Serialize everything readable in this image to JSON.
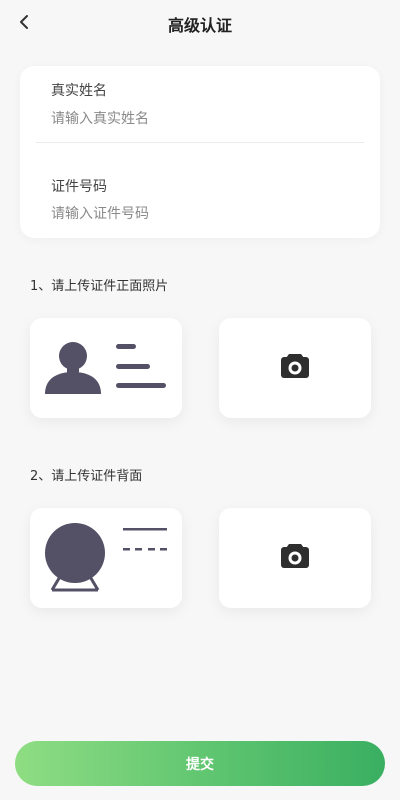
{
  "header": {
    "title": "高级认证",
    "back_icon": "chevron-left-icon"
  },
  "form": {
    "name_label": "真实姓名",
    "name_placeholder": "请输入真实姓名",
    "name_value": "",
    "id_label": "证件号码",
    "id_placeholder": "请输入证件号码",
    "id_value": ""
  },
  "upload_front": {
    "title": "1、请上传证件正面照片",
    "sample_icon": "id-card-front-sample-icon",
    "upload_icon": "camera-icon"
  },
  "upload_back": {
    "title": "2、请上传证件背面",
    "sample_icon": "id-card-back-sample-icon",
    "upload_icon": "camera-icon"
  },
  "submit": {
    "label": "提交"
  },
  "colors": {
    "background": "#f7f7f7",
    "card": "#ffffff",
    "sample_icon": "#545065",
    "submit_gradient_start": "#8fdd83",
    "submit_gradient_end": "#3aaf61"
  }
}
